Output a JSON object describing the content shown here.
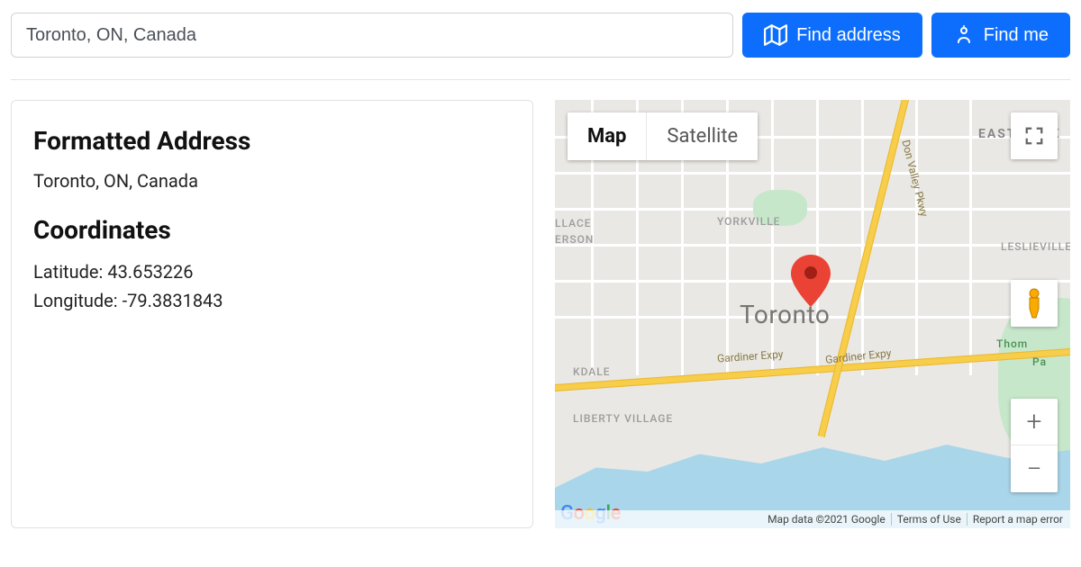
{
  "search": {
    "value": "Toronto, ON, Canada"
  },
  "buttons": {
    "find_address": "Find address",
    "find_me": "Find me"
  },
  "info": {
    "formatted_heading": "Formatted Address",
    "formatted_value": "Toronto, ON, Canada",
    "coords_heading": "Coordinates",
    "lat_label": "Latitude: ",
    "lat_value": "43.653226",
    "lng_label": "Longitude: ",
    "lng_value": "-79.3831843"
  },
  "map": {
    "type_tabs": {
      "map": "Map",
      "satellite": "Satellite",
      "active": "map"
    },
    "city_label": "Toronto",
    "neighborhoods": {
      "wallace": "LLACE",
      "erson": "ERSON",
      "yorkville": "YORKVILLE",
      "leslieville": "LESLIEVILLE",
      "kdale": "KDALE",
      "liberty": "LIBERTY VILLAGE",
      "thom": "Thom",
      "pa": "Pa",
      "eastyork": "EAST YORK"
    },
    "roads": {
      "gardiner1": "Gardiner Expy",
      "gardiner2": "Gardiner Expy",
      "don_valley": "Don Valley Pkwy"
    },
    "zoom": {
      "in": "+",
      "out": "−"
    },
    "attribution": {
      "data": "Map data ©2021 Google",
      "terms": "Terms of Use",
      "report": "Report a map error"
    },
    "logo": "Google"
  }
}
